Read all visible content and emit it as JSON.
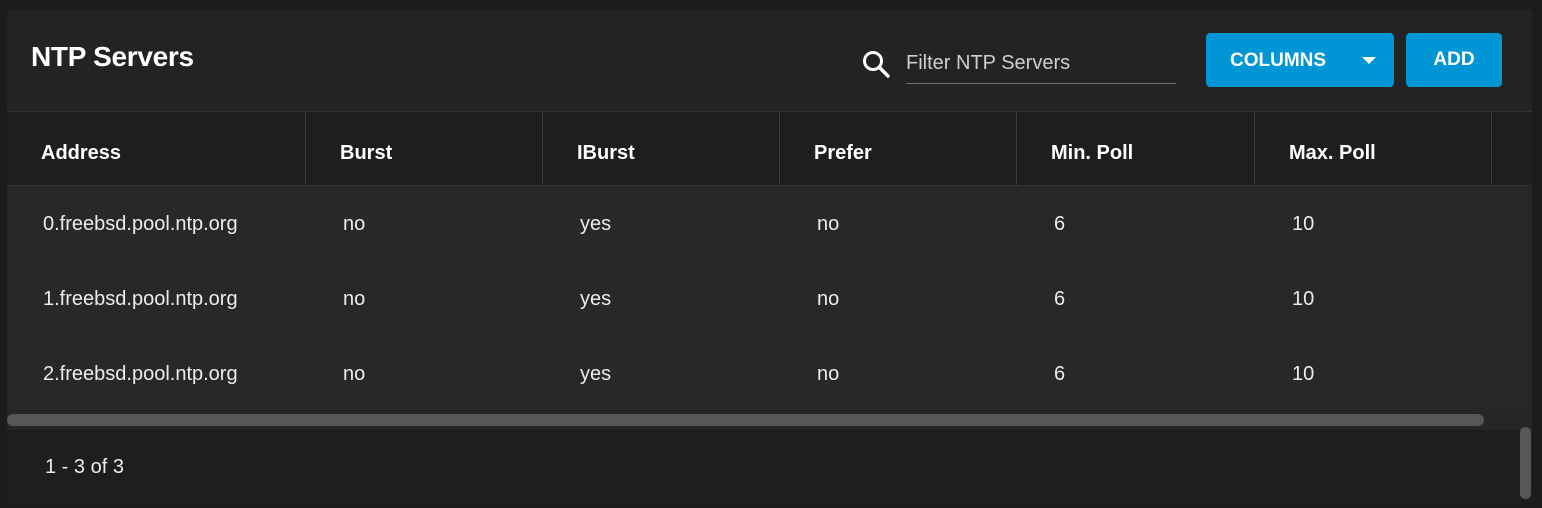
{
  "card": {
    "title": "NTP Servers",
    "search": {
      "placeholder": "Filter NTP Servers",
      "value": ""
    },
    "buttons": {
      "columns_label": "COLUMNS",
      "add_label": "ADD"
    }
  },
  "table": {
    "columns": [
      "Address",
      "Burst",
      "IBurst",
      "Prefer",
      "Min. Poll",
      "Max. Poll"
    ],
    "rows": [
      [
        "0.freebsd.pool.ntp.org",
        "no",
        "yes",
        "no",
        "6",
        "10"
      ],
      [
        "1.freebsd.pool.ntp.org",
        "no",
        "yes",
        "no",
        "6",
        "10"
      ],
      [
        "2.freebsd.pool.ntp.org",
        "no",
        "yes",
        "no",
        "6",
        "10"
      ]
    ]
  },
  "footer": {
    "range_text": "1 - 3 of 3"
  },
  "colors": {
    "accent": "#0095d5",
    "card_bg": "#232323",
    "page_bg": "#1c1c1c"
  },
  "icons": {
    "search": "search-icon",
    "columns_dropdown": "caret-down-icon"
  }
}
